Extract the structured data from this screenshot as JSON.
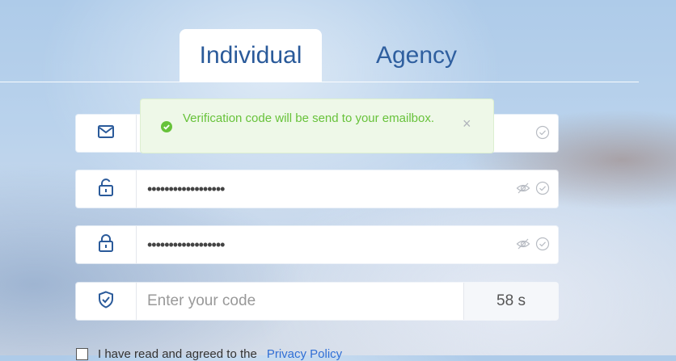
{
  "tabs": {
    "individual": "Individual",
    "agency": "Agency"
  },
  "toast": {
    "message": "Verification code will be send to your emailbox.",
    "close": "×"
  },
  "fields": {
    "email": {
      "value": ""
    },
    "password": {
      "value": "••••••••••••••••••"
    },
    "confirm_password": {
      "value": "••••••••••••••••••"
    },
    "code": {
      "placeholder": "Enter your code",
      "timer": "58 s"
    }
  },
  "agreement": {
    "text": "I have read and agreed to the",
    "link": "Privacy Policy"
  },
  "colors": {
    "brand_blue": "#2a5a9a",
    "success_green": "#67c23a",
    "link": "#2f6fd6"
  },
  "icons": [
    "envelope-icon",
    "unlock-icon",
    "lock-icon",
    "shield-check-icon",
    "eye-hidden-icon",
    "check-circle-icon",
    "success-icon",
    "close-icon"
  ]
}
